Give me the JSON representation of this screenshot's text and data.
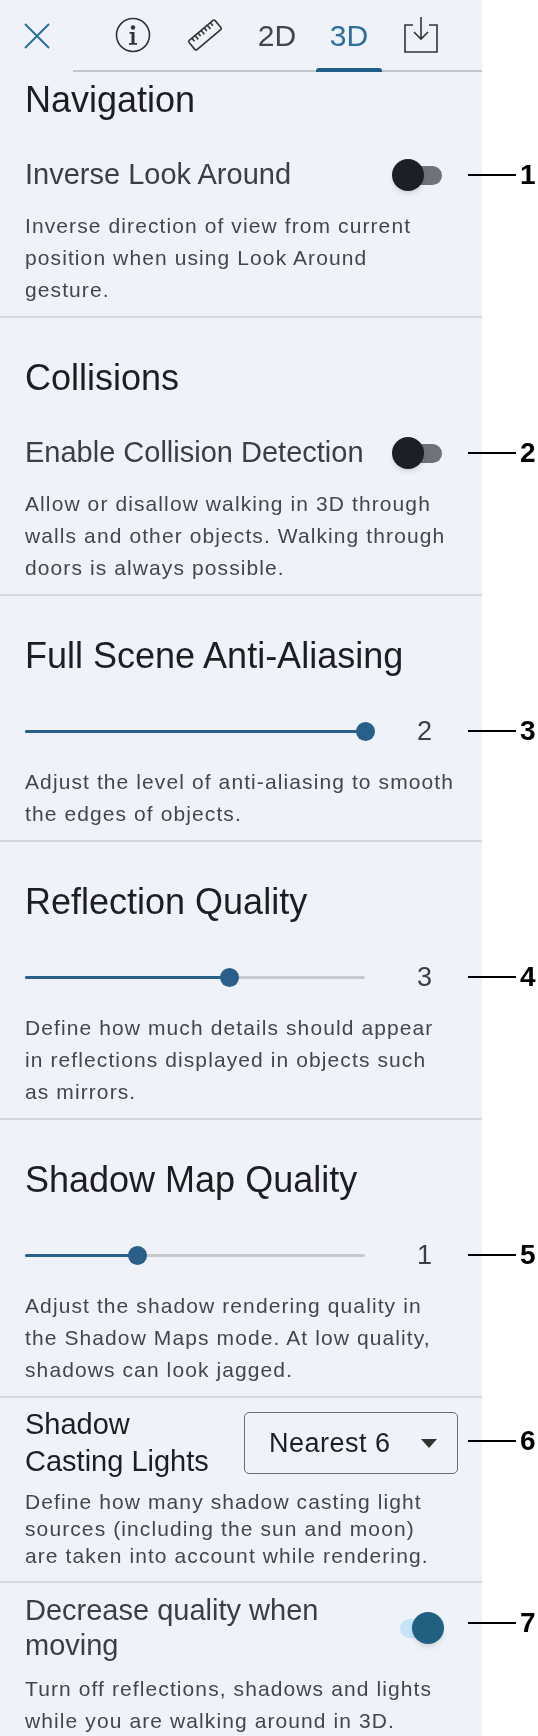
{
  "close_button": {
    "kind": "close"
  },
  "tabs": [
    {
      "kind": "info",
      "selected": false
    },
    {
      "kind": "ruler",
      "selected": false
    },
    {
      "kind": "text",
      "label": "2D",
      "selected": false
    },
    {
      "kind": "text",
      "label": "3D",
      "selected": true
    },
    {
      "kind": "download",
      "selected": false
    }
  ],
  "sections": [
    {
      "kind": "toggle",
      "title": "Navigation",
      "label": "Inverse Look Around",
      "on": false,
      "description": "Inverse direction of view from current position when using Look Around gesture.",
      "callout": "1"
    },
    {
      "kind": "toggle",
      "title": "Collisions",
      "label": "Enable Collision Detection",
      "on": false,
      "description": "Allow or disallow walking in 3D through walls and other objects. Walking through doors is always possible.",
      "callout": "2"
    },
    {
      "kind": "slider",
      "title": "Full Scene Anti-Aliasing",
      "level": 1,
      "value": "2",
      "description": "Adjust the level of anti-aliasing to smooth the edges of objects.",
      "callout": "3"
    },
    {
      "kind": "slider",
      "title": "Reflection Quality",
      "level": 0.6,
      "value": "3",
      "description": "Define how much details should appear in reflections displayed in objects such as mirrors.",
      "callout": "4"
    },
    {
      "kind": "slider",
      "title": "Shadow Map Quality",
      "level": 0.33,
      "value": "1",
      "description": "Adjust the shadow rendering quality in the Shadow Maps mode. At low quality, shadows can look jagged.",
      "callout": "5"
    },
    {
      "kind": "dropdown",
      "label": "Shadow Casting Lights",
      "value": "Nearest 6",
      "description": "Define how many shadow casting light sources (including the sun and moon) are taken into account while rendering.",
      "callout": "6"
    },
    {
      "kind": "toggle-inline",
      "label": "Decrease quality when moving",
      "on": true,
      "description": "Turn off reflections, shadows and lights while you are walking around in 3D.",
      "callout": "7"
    }
  ]
}
